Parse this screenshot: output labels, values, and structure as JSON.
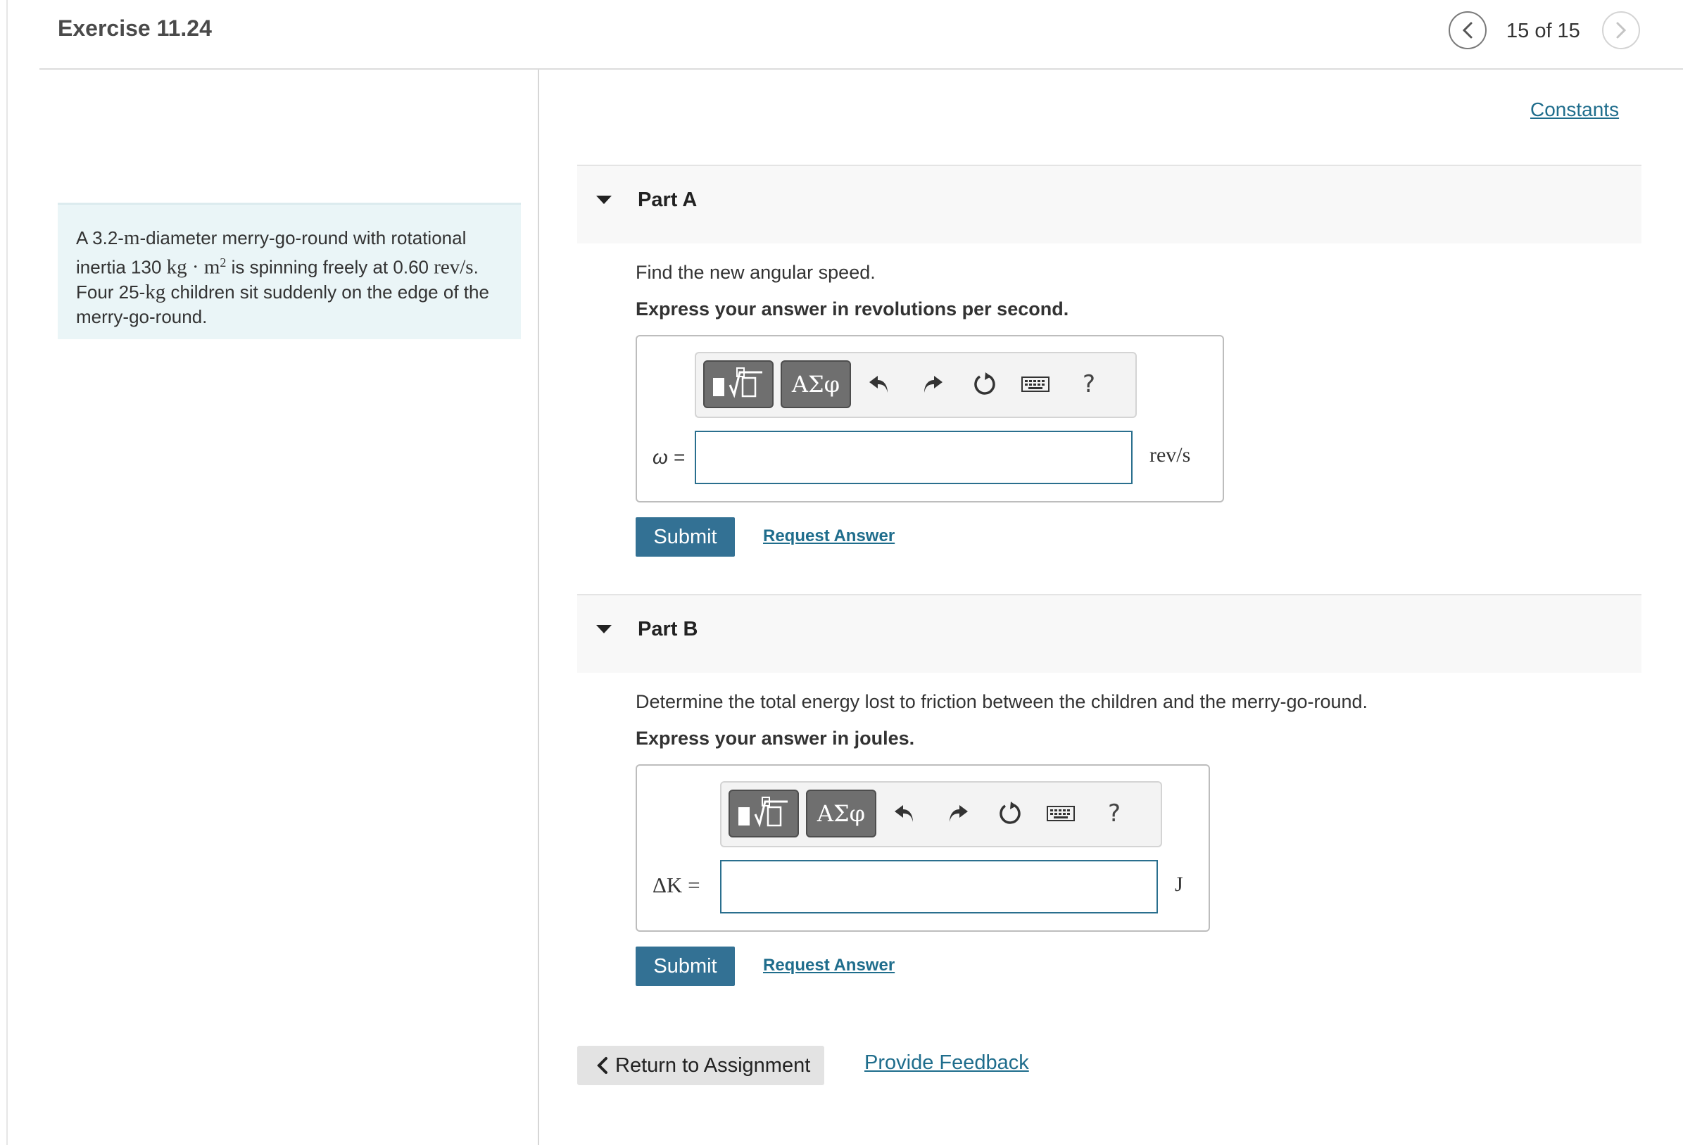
{
  "header": {
    "title": "Exercise 11.24",
    "page_count": "15 of 15"
  },
  "problem": {
    "t1": "A 3.2-",
    "m1": "m",
    "t2": "-diameter merry-go-round with rotational inertia 130 ",
    "m2": "kg · m",
    "sup": "2",
    "t3": " is spinning freely at 0.60 ",
    "m3": "rev/s",
    "t4": ". Four 25-",
    "m4": "kg",
    "t5": " children sit suddenly on the edge of the merry-go-round."
  },
  "constants_link": "Constants",
  "toolbar": {
    "templates_icon": "templates-icon",
    "greek_label": "ΑΣφ",
    "undo_icon": "undo-icon",
    "redo_icon": "redo-icon",
    "reset_icon": "reset-icon",
    "keyboard_icon": "keyboard-icon",
    "help_label": "?"
  },
  "parts": [
    {
      "title": "Part A",
      "question": "Find the new angular speed.",
      "instruction": "Express your answer in revolutions per second.",
      "variable": "ω =",
      "unit": "rev/s",
      "value": "",
      "submit_label": "Submit",
      "request_label": "Request Answer"
    },
    {
      "title": "Part B",
      "question": "Determine the total energy lost to friction between the children and the merry-go-round.",
      "instruction": "Express your answer in joules.",
      "variable": "ΔK =",
      "unit": "J",
      "value": "",
      "submit_label": "Submit",
      "request_label": "Request Answer"
    }
  ],
  "footer": {
    "return_label": "Return to Assignment",
    "feedback_label": "Provide Feedback"
  },
  "colors": {
    "accent": "#337194",
    "link": "#1f6d8c",
    "problem_bg": "#eaf5f7",
    "input_border": "#2a6f8e"
  }
}
